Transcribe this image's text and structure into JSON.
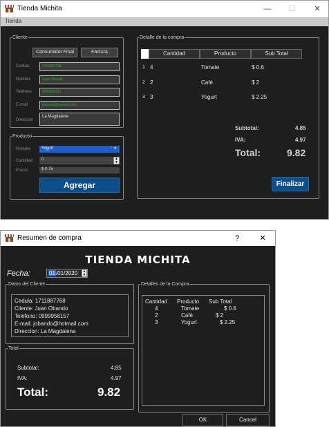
{
  "win1": {
    "title": "Tienda Michita",
    "menu": "Tienda",
    "controls": {
      "minimize": "—",
      "maximize": "☐",
      "close": "✕"
    },
    "cliente": {
      "legend": "Cliente",
      "btn_consumidor_final": "Consumidor Final",
      "btn_factura": "Factura",
      "labels": {
        "cedula": "Cedula",
        "nombre": "Nombre",
        "telefono": "Teléfono",
        "email": "E-mail",
        "direccion": "Dirección"
      },
      "values": {
        "cedula": "1711887768",
        "nombre": "Juan Obando",
        "telefono": "0999958157",
        "email": "jobando@hotmail.com",
        "direccion": "La Magdalene"
      }
    },
    "producto": {
      "legend": "Producto",
      "labels": {
        "nombre": "Nombre",
        "cantidad": "Cantidad",
        "precio": "Precio"
      },
      "nombre_value": "Yogurt",
      "cantidad_value": "0",
      "precio_value": "$ 0.75",
      "btn_agregar": "Agregar"
    },
    "detalle": {
      "legend": "Detalle de la compra",
      "headers": [
        "Cantidad",
        "Producto",
        "Sub Total"
      ],
      "rows": [
        {
          "n": "1",
          "cantidad": "4",
          "producto": "Tomate",
          "subtotal": "$ 0.6"
        },
        {
          "n": "2",
          "cantidad": "2",
          "producto": "Café",
          "subtotal": "$ 2"
        },
        {
          "n": "3",
          "cantidad": "3",
          "producto": "Yogurt",
          "subtotal": "$ 2.25"
        }
      ],
      "subtotal_label": "Subtotal:",
      "subtotal_value": "4.85",
      "iva_label": "IVA:",
      "iva_value": "4.97",
      "total_label": "Total:",
      "total_value": "9.82",
      "btn_finalizar": "Finalizar"
    }
  },
  "win2": {
    "title": "Resumen de compra",
    "controls": {
      "help": "?",
      "close": "✕"
    },
    "brand": "TIENDA MICHITA",
    "fecha_label": "Fecha:",
    "fecha_value_day": "01",
    "fecha_value_rest": "/01/2020",
    "datos_cliente": {
      "legend": "Datos del Cliente",
      "lines": [
        "Cedula: 1711887768",
        "Cliente: Juan Obando",
        "Telefono: 0999958157",
        "E-mail: jobando@hotmail.com",
        "Direccion: La Magdalena"
      ]
    },
    "detalles": {
      "legend": "Detalles de la Compra",
      "headers": [
        "Cantidad",
        "Producto",
        "Sub Total"
      ],
      "rows": [
        {
          "cantidad": "4",
          "producto": "Tomate",
          "subtotal": "$ 0.6"
        },
        {
          "cantidad": "2",
          "producto": "Café",
          "subtotal": "$ 2"
        },
        {
          "cantidad": "3",
          "producto": "Yogurt",
          "subtotal": "$ 2.25"
        }
      ]
    },
    "total": {
      "legend": "Total",
      "subtotal_label": "Subtotal:",
      "subtotal_value": "4.85",
      "iva_label": "IVA:",
      "iva_value": "4.97",
      "total_label": "Total:",
      "total_value": "9.82"
    },
    "btn_ok": "OK",
    "btn_cancel": "Cancel"
  }
}
